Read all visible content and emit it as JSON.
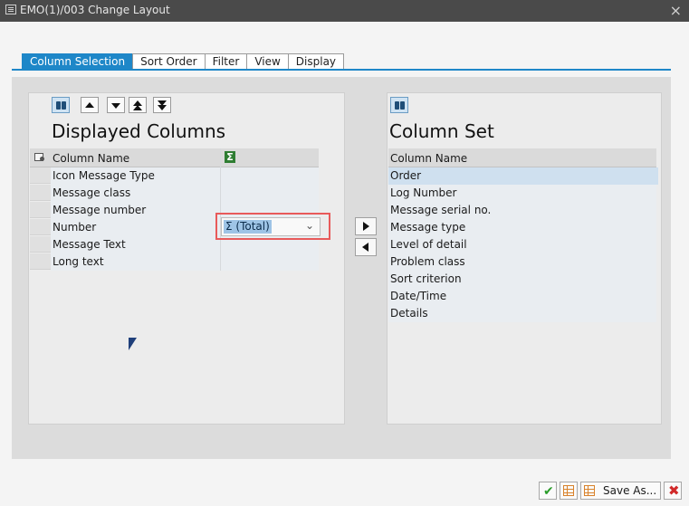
{
  "window": {
    "title": "EMO(1)/003 Change Layout",
    "close_glyph": "×"
  },
  "tabs": [
    {
      "label": "Column Selection",
      "active": true
    },
    {
      "label": "Sort Order",
      "active": false
    },
    {
      "label": "Filter",
      "active": false
    },
    {
      "label": "View",
      "active": false
    },
    {
      "label": "Display",
      "active": false
    }
  ],
  "displayed": {
    "title": "Displayed Columns",
    "header": "Column Name",
    "rows": [
      "Icon Message Type",
      "Message class",
      "Message number",
      "Number",
      "Message Text",
      "Long text"
    ],
    "aggregation": {
      "row_label": "Number",
      "value": "Σ (Total)"
    }
  },
  "column_set": {
    "title": "Column Set",
    "header": "Column Name",
    "rows": [
      "Order",
      "Log Number",
      "Message serial no.",
      "Message type",
      "Level of detail",
      "Problem class",
      "Sort criterion",
      "Date/Time",
      "Details"
    ],
    "selected_row": "Order"
  },
  "footer": {
    "save_as_label": "Save As..."
  },
  "colors": {
    "accent": "#1e87c8",
    "highlight_box": "#e85a5a",
    "confirm": "#2a9d2a",
    "cancel": "#d12a2a"
  }
}
